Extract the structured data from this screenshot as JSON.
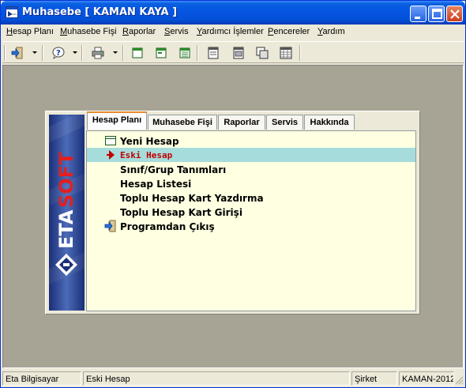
{
  "window": {
    "title": "Muhasebe [ KAMAN KAYA ]"
  },
  "menu": [
    {
      "label": "Hesap Planı",
      "underline_index": 0
    },
    {
      "label": "Muhasebe Fişi",
      "underline_index": 0
    },
    {
      "label": "Raporlar",
      "underline_index": 0
    },
    {
      "label": "Servis",
      "underline_index": 0
    },
    {
      "label": "Yardımcı İşlemler",
      "underline_index": 0
    },
    {
      "label": "Pencereler",
      "underline_index": 0
    },
    {
      "label": "Yardım",
      "underline_index": 0
    }
  ],
  "toolbar": {
    "icons": [
      "exit-icon",
      "help-icon",
      "printer-icon",
      "window-icon",
      "form-icon",
      "list-icon",
      "card-icon",
      "report-icon",
      "copy-icon",
      "grid-icon"
    ]
  },
  "tabs": [
    {
      "label": "Hesap Planı",
      "active": true
    },
    {
      "label": "Muhasebe Fişi",
      "active": false
    },
    {
      "label": "Raporlar",
      "active": false
    },
    {
      "label": "Servis",
      "active": false
    },
    {
      "label": "Hakkında",
      "active": false
    }
  ],
  "menu_items": [
    {
      "label": "Yeni Hesap",
      "icon": "window-icon",
      "selected": false
    },
    {
      "label": "Eski Hesap",
      "icon": "arrow-icon",
      "selected": true
    },
    {
      "label": "Sınıf/Grup Tanımları",
      "icon": "",
      "selected": false
    },
    {
      "label": "Hesap Listesi",
      "icon": "",
      "selected": false
    },
    {
      "label": "Toplu Hesap Kart Yazdırma",
      "icon": "",
      "selected": false
    },
    {
      "label": "Toplu Hesap Kart Girişi",
      "icon": "",
      "selected": false
    },
    {
      "label": "Programdan Çıkış",
      "icon": "exit-icon",
      "selected": false
    }
  ],
  "logo": {
    "text": "ETASOFT"
  },
  "status": [
    "Eta Bilgisayar",
    "Eski Hesap",
    "Şirket",
    "KAMAN-2012"
  ],
  "colors": {
    "selected_row": "#a6dcdb",
    "selected_text": "#c00000",
    "content_bg": "#ffffe1",
    "mdi_bg": "#a7a495",
    "tab_accent": "#e68b2c"
  }
}
